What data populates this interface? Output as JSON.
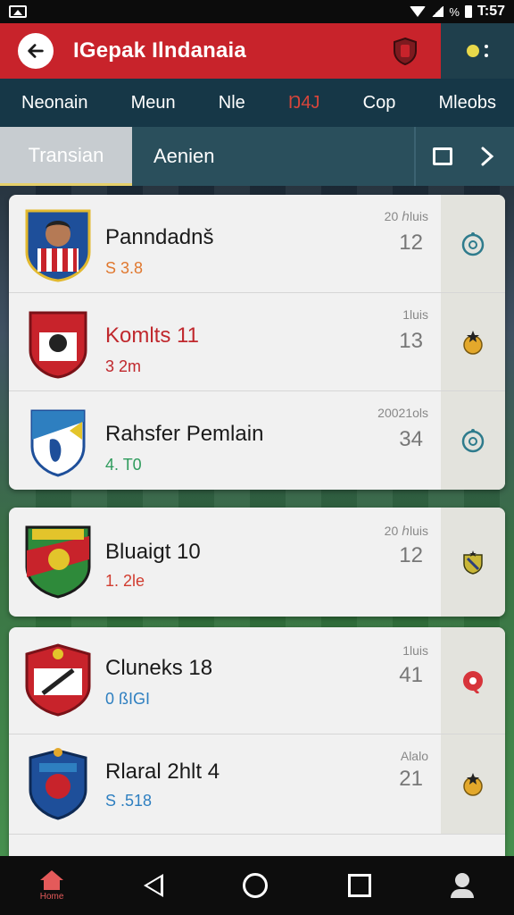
{
  "status_bar": {
    "battery_pct": "%",
    "time": "T:57"
  },
  "app_bar": {
    "title": "IGepak Ilndanaia"
  },
  "nav_tabs": [
    {
      "label": "Neonain"
    },
    {
      "label": "Meun"
    },
    {
      "label": "Nle"
    },
    {
      "label": "Ŋ4J"
    },
    {
      "label": "Cop"
    },
    {
      "label": "Mleobs"
    }
  ],
  "sub_tabs": {
    "selected": "Transian",
    "other": "Aenien"
  },
  "cards": [
    {
      "rows": [
        {
          "name": "Panndadnš",
          "sub": "S 3.8",
          "sub_color": "#e0782f",
          "meta": "20 ℎluis",
          "num": "12",
          "side_color": "#2e7b8c"
        },
        {
          "name": "Komlts 11",
          "sub": "3 2m",
          "sub_color": "#c0282d",
          "name_color": "#c0282d",
          "meta": "1luis",
          "num": "13",
          "side_color": "#e3a82b"
        },
        {
          "name": "Rahsfer Pemlain",
          "sub": "4. T0",
          "sub_color": "#2e9b5c",
          "meta": "20021ols",
          "num": "34",
          "side_color": "#2e7b8c"
        }
      ]
    },
    {
      "rows": [
        {
          "name": "Bluaigt 10",
          "sub": "1. 2le",
          "sub_color": "#d13c2f",
          "meta": "20 ℎluis",
          "num": "12",
          "side_color": "#c9b637"
        }
      ]
    },
    {
      "rows": [
        {
          "name": "Cluneks 18",
          "sub": "0 ßIGI",
          "sub_color": "#2e7fc0",
          "meta": "1luis",
          "num": "41",
          "side_color": "#d7343a"
        },
        {
          "name": "Rlaral 2hlt   4",
          "sub": "S .518",
          "sub_color": "#2e7fc0",
          "meta": "Alalo",
          "num": "21",
          "side_color": "#e3a82b"
        }
      ]
    }
  ],
  "bottom_nav": {
    "home_label": "Home"
  }
}
